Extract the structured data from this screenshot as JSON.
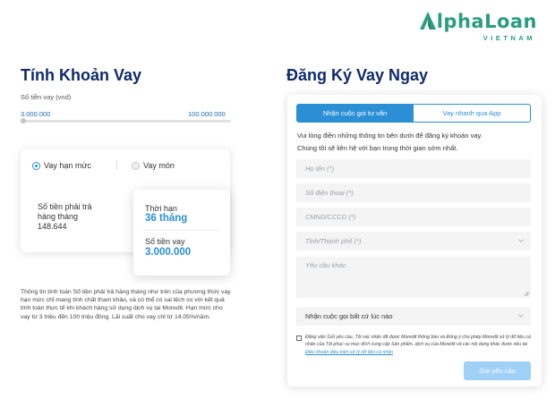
{
  "logo": {
    "brand": "alphaLoan",
    "tagline": "VIETNAM",
    "brand_color": "#2a9d7f"
  },
  "calculator": {
    "title": "Tính Khoản Vay",
    "amount_label": "Số tiền vay (vnd)",
    "range_min": "3.000.000",
    "range_max": "100.000.000",
    "slider_value_fraction": 0,
    "options": [
      {
        "label": "Vay hạn mức",
        "selected": true
      },
      {
        "label": "Vay món",
        "selected": false
      }
    ],
    "monthly_payment_label": "Số tiền phải trả hàng tháng",
    "monthly_payment_value": "148.644",
    "term_label": "Thời hạn",
    "term_value": "36 tháng",
    "loan_amount_label": "Số tiền vay",
    "loan_amount_value": "3.000.000",
    "disclaimer": "Thông tin tính toán Số tiền phải trả hàng tháng như trên của phương thức vay hạn mức chỉ mang tính chất tham khảo, và có thể có sai lệch so với kết quả tính toán thực tế khi khách hàng sử dụng dịch vụ tại Moredit. Hạn mức cho vay từ 3 triệu đến 100 triệu đồng. Lãi suất cho vay chỉ từ 14.05%/năm."
  },
  "form": {
    "title": "Đăng Ký Vay Ngay",
    "tabs": [
      {
        "label": "Nhận cuộc gọi tư vấn",
        "active": true
      },
      {
        "label": "Vay nhanh qua App",
        "active": false
      }
    ],
    "intro_line1": "Vui lòng điền những thông tin bên dưới để đăng ký khoản vay.",
    "intro_line2": "Chúng tôi sẽ liên hệ với bạn trong thời gian sớm nhất.",
    "placeholders": {
      "name": "Họ tên (*)",
      "phone": "Số điện thoại (*)",
      "id_number": "CMND/CCCD (*)",
      "province": "Tỉnh/Thành phố (*)",
      "notes": "Yêu cầu khác"
    },
    "call_time_select": "Nhận cuộc gọi bất cứ lúc nào",
    "consent_text": "Đăng việc Gửi yêu cầu, Tôi xác nhận đã được Moredit thông báo và Đồng ý cho phép Moredit sử lý dữ liệu cá nhân của Tôi phục vụ mục đích cung cấp Sản phẩm, dịch vụ của Moredit và các nội dung khác được nêu tại",
    "consent_link": "Điều khoản điều kiện xử lý dữ liệu cá nhân",
    "submit_label": "Gửi yêu cầu",
    "accent_color": "#2b8fd6"
  }
}
